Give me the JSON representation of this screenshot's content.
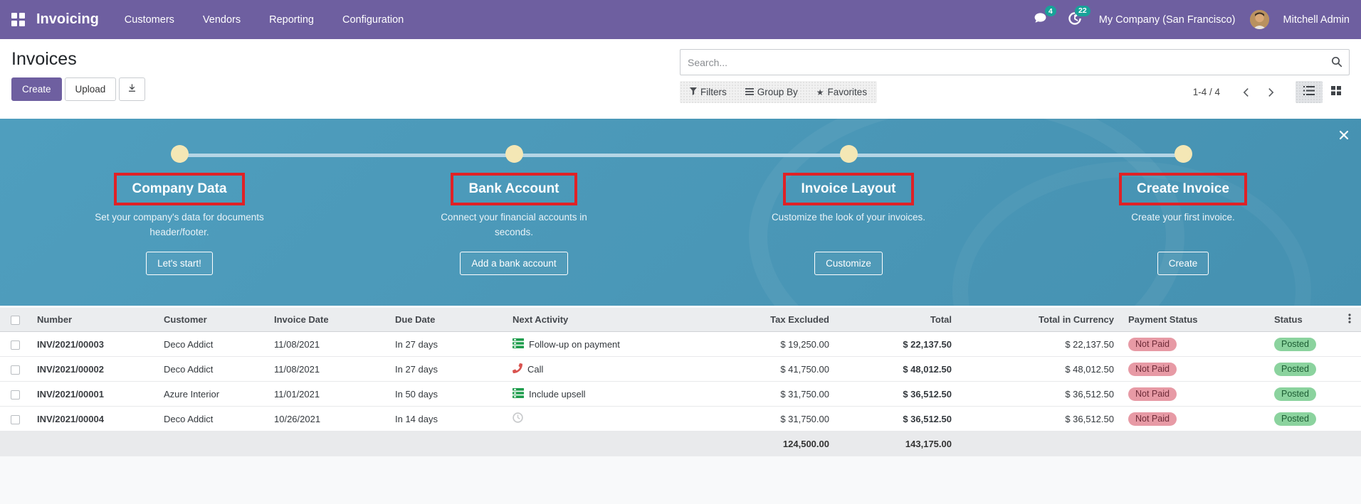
{
  "navbar": {
    "app_name": "Invoicing",
    "menus": [
      "Customers",
      "Vendors",
      "Reporting",
      "Configuration"
    ],
    "messages_badge": "4",
    "activities_badge": "22",
    "company": "My Company (San Francisco)",
    "user": "Mitchell Admin"
  },
  "control_panel": {
    "title": "Invoices",
    "create_label": "Create",
    "upload_label": "Upload",
    "search_placeholder": "Search...",
    "filters_label": "Filters",
    "group_by_label": "Group By",
    "favorites_label": "Favorites",
    "pager": "1-4 / 4"
  },
  "banner": {
    "steps": [
      {
        "title": "Company Data",
        "subtitle": "Set your company's data for documents header/footer.",
        "button": "Let's start!"
      },
      {
        "title": "Bank Account",
        "subtitle": "Connect your financial accounts in seconds.",
        "button": "Add a bank account"
      },
      {
        "title": "Invoice Layout",
        "subtitle": "Customize the look of your invoices.",
        "button": "Customize"
      },
      {
        "title": "Create Invoice",
        "subtitle": "Create your first invoice.",
        "button": "Create"
      }
    ]
  },
  "table": {
    "columns": [
      "Number",
      "Customer",
      "Invoice Date",
      "Due Date",
      "Next Activity",
      "Tax Excluded",
      "Total",
      "Total in Currency",
      "Payment Status",
      "Status"
    ],
    "rows": [
      {
        "number": "INV/2021/00003",
        "customer": "Deco Addict",
        "invoice_date": "11/08/2021",
        "due_date": "In 27 days",
        "activity_icon": "tasks-icon",
        "activity": "Follow-up on payment",
        "tax_excluded": "$ 19,250.00",
        "total": "$ 22,137.50",
        "total_in_currency": "$ 22,137.50",
        "payment_status": "Not Paid",
        "status": "Posted"
      },
      {
        "number": "INV/2021/00002",
        "customer": "Deco Addict",
        "invoice_date": "11/08/2021",
        "due_date": "In 27 days",
        "activity_icon": "phone-icon",
        "activity": "Call",
        "tax_excluded": "$ 41,750.00",
        "total": "$ 48,012.50",
        "total_in_currency": "$ 48,012.50",
        "payment_status": "Not Paid",
        "status": "Posted"
      },
      {
        "number": "INV/2021/00001",
        "customer": "Azure Interior",
        "invoice_date": "11/01/2021",
        "due_date": "In 50 days",
        "activity_icon": "tasks-icon",
        "activity": "Include upsell",
        "tax_excluded": "$ 31,750.00",
        "total": "$ 36,512.50",
        "total_in_currency": "$ 36,512.50",
        "payment_status": "Not Paid",
        "status": "Posted"
      },
      {
        "number": "INV/2021/00004",
        "customer": "Deco Addict",
        "invoice_date": "10/26/2021",
        "due_date": "In 14 days",
        "activity_icon": "clock-icon",
        "activity": "",
        "tax_excluded": "$ 31,750.00",
        "total": "$ 36,512.50",
        "total_in_currency": "$ 36,512.50",
        "payment_status": "Not Paid",
        "status": "Posted"
      }
    ],
    "totals": {
      "tax_excluded": "124,500.00",
      "total": "143,175.00"
    }
  },
  "colors": {
    "navbar_purple": "#6e5fa0",
    "banner_teal": "#4e9cbd",
    "annotation_red": "#e02126",
    "badge_teal": "#18a299",
    "not_paid_bg": "#e79aa5",
    "posted_bg": "#8bd39e",
    "progress_line": "#b5d5e5",
    "step_dot": "#f4e7b5"
  }
}
